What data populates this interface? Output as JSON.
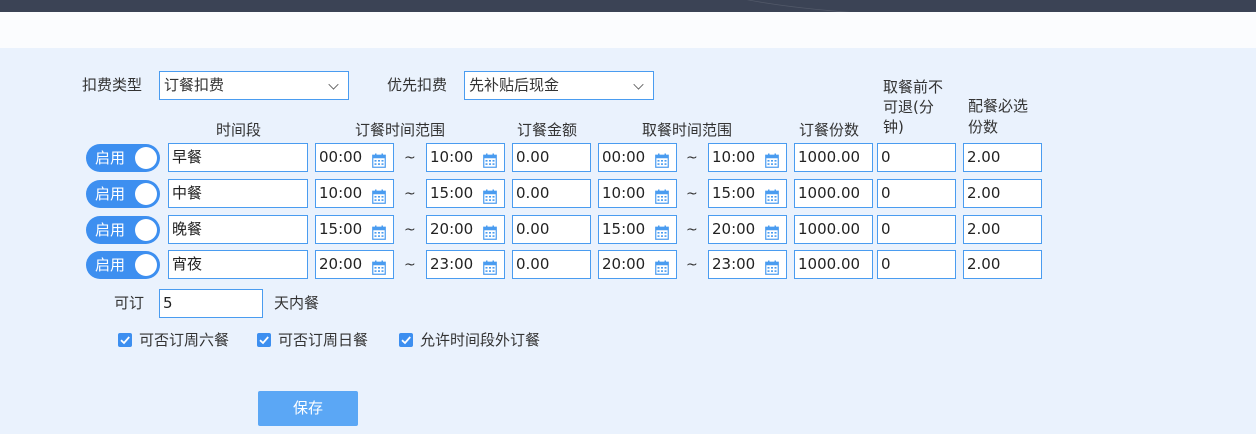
{
  "filters": {
    "fee_type_label": "扣费类型",
    "fee_type_value": "订餐扣费",
    "priority_label": "优先扣费",
    "priority_value": "先补贴后现金"
  },
  "headers": {
    "period": "时间段",
    "order_time_range": "订餐时间范围",
    "order_amount": "订餐金额",
    "pickup_time_range": "取餐时间范围",
    "order_quantity": "订餐份数",
    "no_refund_before_pickup": [
      "取餐前不",
      "可退(分",
      "钟)"
    ],
    "required_side_quantity": [
      "配餐必选",
      "份数"
    ]
  },
  "rows": [
    {
      "toggle": "启用",
      "name": "早餐",
      "order_start": "00:00",
      "order_end": "10:00",
      "amount": "0.00",
      "pick_start": "00:00",
      "pick_end": "10:00",
      "qty": "1000.00",
      "refund": "0",
      "side": "2.00"
    },
    {
      "toggle": "启用",
      "name": "中餐",
      "order_start": "10:00",
      "order_end": "15:00",
      "amount": "0.00",
      "pick_start": "10:00",
      "pick_end": "15:00",
      "qty": "1000.00",
      "refund": "0",
      "side": "2.00"
    },
    {
      "toggle": "启用",
      "name": "晚餐",
      "order_start": "15:00",
      "order_end": "20:00",
      "amount": "0.00",
      "pick_start": "15:00",
      "pick_end": "20:00",
      "qty": "1000.00",
      "refund": "0",
      "side": "2.00"
    },
    {
      "toggle": "启用",
      "name": "宵夜",
      "order_start": "20:00",
      "order_end": "23:00",
      "amount": "0.00",
      "pick_start": "20:00",
      "pick_end": "23:00",
      "qty": "1000.00",
      "refund": "0",
      "side": "2.00"
    }
  ],
  "tilde": "~",
  "days": {
    "prefix": "可订",
    "value": "5",
    "suffix": "天内餐"
  },
  "options": [
    {
      "label": "可否订周六餐",
      "checked": true
    },
    {
      "label": "可否订周日餐",
      "checked": true
    },
    {
      "label": "允许时间段外订餐",
      "checked": true
    }
  ],
  "save_label": "保存",
  "colors": {
    "accent": "#3d8ff0",
    "field_border": "#4a9cf0",
    "background": "#eaf2fd",
    "save_button": "#5ba7f5"
  }
}
